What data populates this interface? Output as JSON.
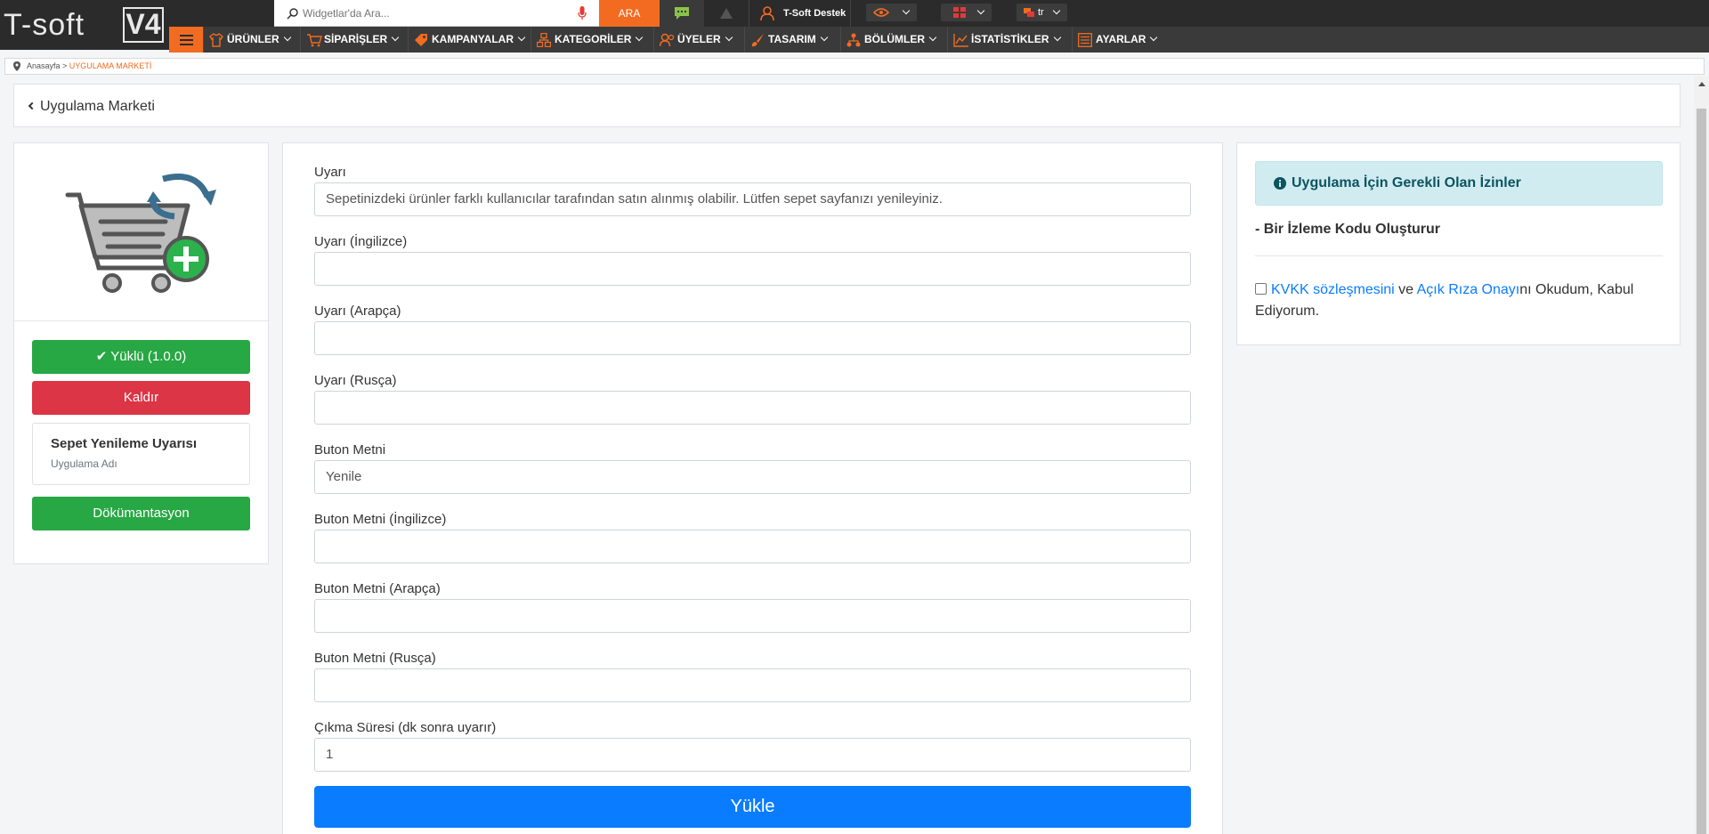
{
  "topbar": {
    "logo_text": "T-soft",
    "logo_version": "V4",
    "search_placeholder": "Widgetlar'da Ara...",
    "search_button": "ARA",
    "support_label": "T-Soft Destek",
    "language": "tr"
  },
  "nav": {
    "items": [
      {
        "label": "ÜRÜNLER",
        "icon": "shirt-icon"
      },
      {
        "label": "SİPARİŞLER",
        "icon": "cart-icon"
      },
      {
        "label": "KAMPANYALAR",
        "icon": "tag-icon"
      },
      {
        "label": "KATEGORİLER",
        "icon": "sitemap-icon"
      },
      {
        "label": "ÜYELER",
        "icon": "users-icon"
      },
      {
        "label": "TASARIM",
        "icon": "brush-icon"
      },
      {
        "label": "BÖLÜMLER",
        "icon": "sections-icon"
      },
      {
        "label": "İSTATİSTİKLER",
        "icon": "chart-icon"
      },
      {
        "label": "AYARLAR",
        "icon": "settings-list-icon"
      }
    ]
  },
  "breadcrumb": {
    "home": "Anasayfa",
    "separator": " > ",
    "current": "UYGULAMA MARKETİ"
  },
  "header": {
    "back_label": "Uygulama Marketi"
  },
  "app": {
    "installed_label": "Yüklü (1.0.0)",
    "remove_label": "Kaldır",
    "name": "Sepet Yenileme Uyarısı",
    "name_caption": "Uygulama Adı",
    "docs_label": "Dökümantasyon"
  },
  "form": {
    "fields": [
      {
        "label": "Uyarı",
        "value": "Sepetinizdeki ürünler farklı kullanıcılar tarafından satın alınmış olabilir. Lütfen sepet sayfanızı yenileyiniz."
      },
      {
        "label": "Uyarı (İngilizce)",
        "value": ""
      },
      {
        "label": "Uyarı (Arapça)",
        "value": ""
      },
      {
        "label": "Uyarı (Rusça)",
        "value": ""
      },
      {
        "label": "Buton Metni",
        "value": "Yenile"
      },
      {
        "label": "Buton Metni (İngilizce)",
        "value": ""
      },
      {
        "label": "Buton Metni (Arapça)",
        "value": ""
      },
      {
        "label": "Buton Metni (Rusça)",
        "value": ""
      },
      {
        "label": "Çıkma Süresi (dk sonra uyarır)",
        "value": "1"
      }
    ],
    "submit_label": "Yükle"
  },
  "permissions": {
    "title": "Uygulama İçin Gerekli Olan İzinler",
    "items": [
      "- Bir İzleme Kodu Oluşturur"
    ],
    "kvkk_link": "KVKK sözleşmesini",
    "kvkk_and": " ve ",
    "consent_link": "Açık Rıza Onayı",
    "consent_suffix": "nı Okudum, Kabul Ediyorum."
  },
  "colors": {
    "brand_orange": "#f26b21",
    "success": "#28a745",
    "danger": "#dc3545",
    "primary": "#0a7cff",
    "info_bg": "#d1ecf1"
  }
}
